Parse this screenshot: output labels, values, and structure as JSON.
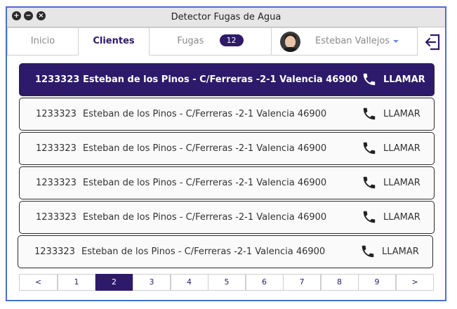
{
  "window": {
    "title": "Detector Fugas de Agua"
  },
  "titlebar_buttons": [
    "plus-icon",
    "minus-icon",
    "close-icon"
  ],
  "tabs": {
    "inicio": "Inicio",
    "clientes": "Clientes",
    "fugas": "Fugas",
    "fugas_count": "12"
  },
  "user": {
    "name": "Esteban Vallejos"
  },
  "call_label": "LLAMAR",
  "rows": [
    {
      "id": "1233323",
      "address": "Esteban de los Pinos - C/Ferreras -2-1 Valencia 46900",
      "selected": true
    },
    {
      "id": "1233323",
      "address": "Esteban de los Pinos - C/Ferreras -2-1 Valencia 46900",
      "selected": false
    },
    {
      "id": "1233323",
      "address": "Esteban de los Pinos - C/Ferreras -2-1 Valencia 46900",
      "selected": false
    },
    {
      "id": "1233323",
      "address": "Esteban de los Pinos - C/Ferreras -2-1 Valencia 46900",
      "selected": false
    },
    {
      "id": "1233323",
      "address": "Esteban de los Pinos - C/Ferreras -2-1 Valencia 46900",
      "selected": false
    },
    {
      "id": "1233323",
      "address": "Esteban de los Pinos - C/Ferreras -2-1 Valencia 46900",
      "selected": false
    }
  ],
  "pagination": {
    "prev": "<",
    "next": ">",
    "pages": [
      "1",
      "2",
      "3",
      "4",
      "5",
      "6",
      "7",
      "8",
      "9"
    ],
    "current": "2"
  },
  "colors": {
    "accent": "#2d1a6b",
    "window_border": "#4a6fd0",
    "caret": "#6d8ad8"
  }
}
